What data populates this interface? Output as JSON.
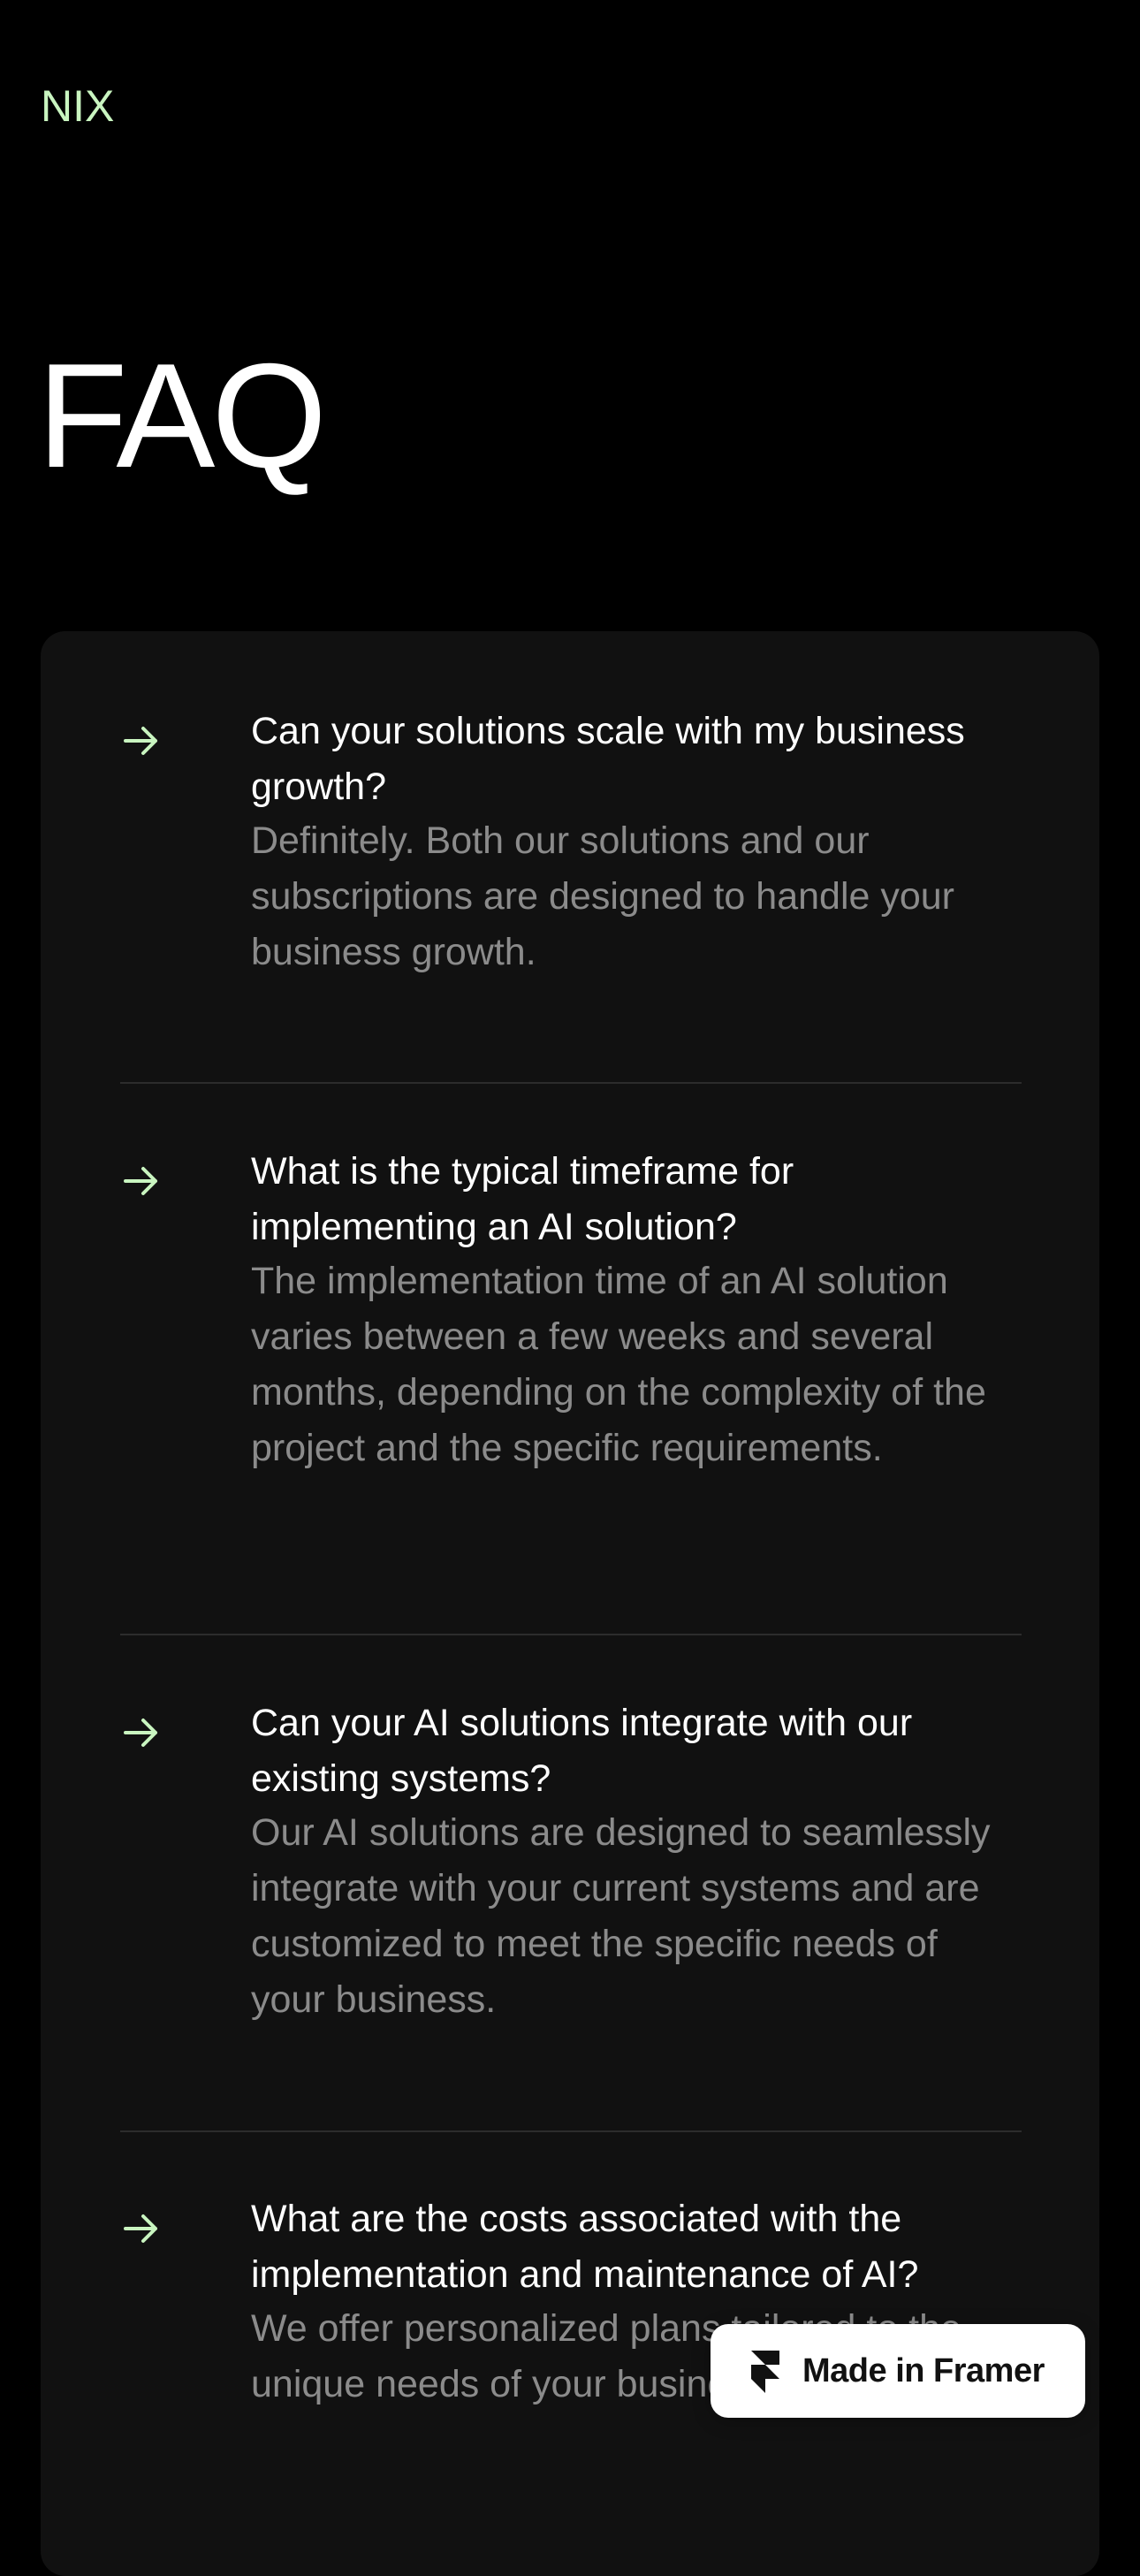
{
  "header": {
    "logo": "NIX"
  },
  "page": {
    "title": "FAQ"
  },
  "faq": {
    "items": [
      {
        "question": "Can your solutions scale with my business growth?",
        "answer": "Definitely. Both our solutions and our subscriptions are designed to handle your business growth."
      },
      {
        "question": "What is the typical timeframe for implementing an AI solution?",
        "answer": "The implementation time of an AI solution varies between a few weeks and several months, depending on the complexity of the project and the specific requirements."
      },
      {
        "question": "Can your AI solutions integrate with our existing systems?",
        "answer": "Our AI solutions are designed to seamlessly integrate with your current systems and are customized to meet the specific needs of your business."
      },
      {
        "question": "What are the costs associated with the implementation and maintenance of AI?",
        "answer": "We offer personalized plans tailored to the unique needs of your business,"
      }
    ]
  },
  "badge": {
    "label": "Made in Framer"
  },
  "colors": {
    "accent": "#c9f5c0",
    "background": "#000000",
    "card": "#111111",
    "answer_text": "#8b8b8b"
  },
  "icons": {
    "faq_arrow": "arrow-right-icon",
    "badge": "framer-logo-icon"
  }
}
